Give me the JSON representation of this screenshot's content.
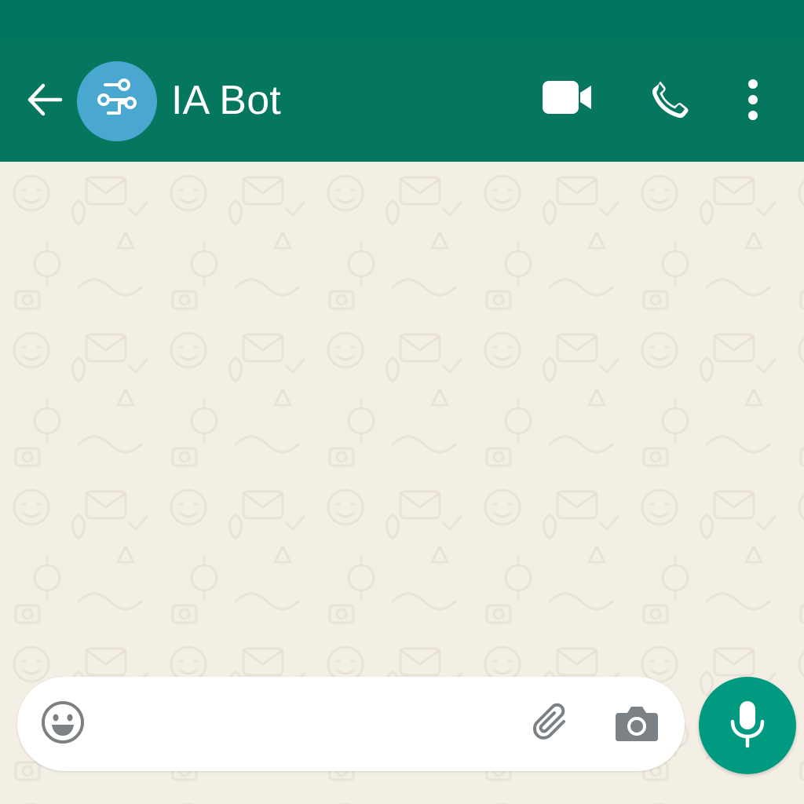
{
  "contact": {
    "name": "IA Bot",
    "avatar_icon": "circuit-bot-icon"
  },
  "header": {
    "back_icon": "arrow-left-icon",
    "video_call_icon": "video-camera-icon",
    "voice_call_icon": "phone-icon",
    "menu_icon": "more-vertical-icon"
  },
  "composer": {
    "emoji_icon": "emoji-smile-icon",
    "placeholder": "",
    "value": "",
    "attach_icon": "paperclip-icon",
    "camera_icon": "camera-icon",
    "mic_icon": "microphone-icon"
  },
  "colors": {
    "header": "#05775f",
    "status_bar": "#00765f",
    "chat_background": "#f3efe5",
    "accent": "#009a81",
    "avatar": "#4aa7cf"
  }
}
